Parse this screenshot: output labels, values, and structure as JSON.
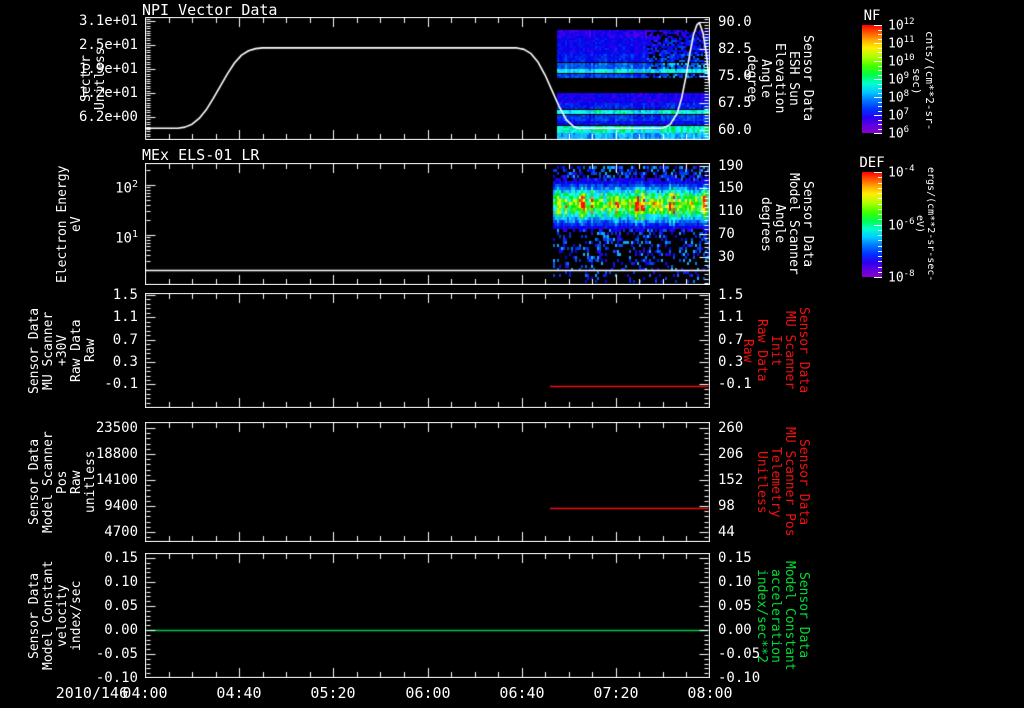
{
  "figure": {
    "background": "#000000",
    "axis_color": "#ffffff",
    "x_axis": {
      "date_label": "2010/146",
      "tick_labels": [
        "04:00",
        "04:40",
        "05:20",
        "06:00",
        "06:40",
        "07:20",
        "08:00"
      ],
      "minor_ticks_per_major": 4
    },
    "panels": [
      {
        "title": "NPI Vector Data",
        "left_label_lines": [
          "Sector",
          "Unitless"
        ],
        "left_tick_labels": [
          "3.1e+01",
          "2.5e+01",
          "1.9e+01",
          "1.2e+01",
          "6.2e+00"
        ],
        "right_tick_labels": [
          "90.0",
          "82.5",
          "75.0",
          "67.5",
          "60.0"
        ],
        "right_label_lines": [
          "Sensor Data",
          "ESH Sun Elevation",
          "Angle",
          "degree"
        ],
        "right_label_color": "#ffffff",
        "colorbar": {
          "title": "NF",
          "unit": "cnts/(cm**2-sr-sec)",
          "tick_mantissa": "10",
          "tick_exponents": [
            "12",
            "11",
            "10",
            "9",
            "8",
            "7",
            "6"
          ]
        }
      },
      {
        "title": "MEx ELS-01 LR",
        "left_label_lines": [
          "Electron Energy",
          "eV"
        ],
        "left_tick_labels_exp": [
          {
            "m": "10",
            "e": "2"
          },
          {
            "m": "10",
            "e": "1"
          }
        ],
        "right_tick_labels": [
          "190",
          "150",
          "110",
          "70",
          "30"
        ],
        "right_label_lines": [
          "Sensor Data",
          "Model Scanner",
          "Angle",
          "degrees"
        ],
        "right_label_color": "#ffffff",
        "colorbar": {
          "title": "DEF",
          "unit": "ergs/(cm**2-sr-sec-eV)",
          "tick_mantissa": "10",
          "tick_exponents": [
            "-4",
            "-6",
            "-8"
          ]
        }
      },
      {
        "left_label_lines": [
          "Sensor Data",
          "MU Scanner +30V",
          "Raw Data",
          "Raw"
        ],
        "left_tick_labels": [
          "1.5",
          "1.1",
          "0.7",
          "0.3",
          "-0.1"
        ],
        "right_tick_labels": [
          "1.5",
          "1.1",
          "0.7",
          "0.3",
          "-0.1"
        ],
        "right_label_lines": [
          "Sensor Data",
          "MU Scanner Init",
          "Raw Data",
          "Raw"
        ],
        "right_label_color": "#f01010"
      },
      {
        "left_label_lines": [
          "Sensor Data",
          "Model Scanner Pos",
          "Raw",
          "unitless"
        ],
        "left_tick_labels": [
          "23500",
          "18800",
          "14100",
          "9400",
          "4700"
        ],
        "right_tick_labels": [
          "260",
          "206",
          "152",
          "98",
          "44"
        ],
        "right_label_lines": [
          "Sensor Data",
          "MU Scanner Pos",
          "Telemetry",
          "Unitless"
        ],
        "right_label_color": "#f01010"
      },
      {
        "left_label_lines": [
          "Sensor Data",
          "Model Constant",
          "velocity",
          "index/sec"
        ],
        "left_tick_labels": [
          "0.15",
          "0.10",
          "0.05",
          "0.00",
          "-0.05",
          "-0.10"
        ],
        "right_tick_labels": [
          "0.15",
          "0.10",
          "0.05",
          "0.00",
          "-0.05",
          "-0.10"
        ],
        "right_label_lines": [
          "Sensor Data",
          "Model Constant",
          "acceleration",
          "index/sec**2"
        ],
        "right_label_color": "#00dd33"
      }
    ]
  },
  "chart_data": [
    {
      "type": "line",
      "panel": 1,
      "title": "NPI Vector Data",
      "x_axis": {
        "start": "2010/146 04:00",
        "end": "2010/146 08:00",
        "unit": "minutes after 04:00"
      },
      "left_axis": {
        "label": "Sector Unitless",
        "ticks": [
          31,
          25,
          19,
          12,
          6.2
        ]
      },
      "right_axis": {
        "label": "Sensor Data ESH Sun Elevation Angle degree",
        "ticks": [
          90.0,
          82.5,
          75.0,
          67.5,
          60.0
        ],
        "range": [
          60,
          90
        ]
      },
      "series": [
        {
          "name": "ESH Sun Elevation Angle",
          "axis": "right",
          "color": "#ffffff",
          "points_min_deg": [
            [
              0,
              60.5
            ],
            [
              14,
              60.5
            ],
            [
              17,
              60.8
            ],
            [
              20,
              61.6
            ],
            [
              23,
              63.2
            ],
            [
              26,
              65.6
            ],
            [
              29,
              68.8
            ],
            [
              32,
              72.2
            ],
            [
              35,
              75.6
            ],
            [
              38,
              78.6
            ],
            [
              41,
              80.8
            ],
            [
              44,
              82.0
            ],
            [
              47,
              82.6
            ],
            [
              50,
              82.8
            ],
            [
              158,
              82.8
            ],
            [
              161,
              82.4
            ],
            [
              164,
              81.2
            ],
            [
              167,
              78.8
            ],
            [
              170,
              75.2
            ],
            [
              173,
              70.8
            ],
            [
              176,
              66.4
            ],
            [
              179,
              62.8
            ],
            [
              182,
              61.0
            ],
            [
              184,
              60.5
            ],
            [
              220,
              60.5
            ],
            [
              223,
              61.5
            ],
            [
              226,
              64.5
            ],
            [
              228,
              69.0
            ],
            [
              230,
              75.5
            ],
            [
              231.5,
              81.5
            ],
            [
              233,
              86.5
            ],
            [
              234.5,
              89.3
            ],
            [
              235.5,
              89.8
            ],
            [
              237,
              87.0
            ],
            [
              238.5,
              81.0
            ],
            [
              239.5,
              74.5
            ],
            [
              240,
              71.0
            ]
          ]
        }
      ],
      "spectrogram": {
        "name": "NPI counts NF",
        "unit": "cnts/(cm**2-sr-sec)",
        "color_scale_range": [
          "1e6",
          "1e12"
        ],
        "starts_at_min": 172,
        "ends_at_min": 240,
        "bands": [
          {
            "y_frac_top": 0.105,
            "y_frac_bottom": 0.49,
            "description": "dark blue/purple rows, bright cyan stripe near band bottom, black dropouts and purple blobs on right third"
          },
          {
            "y_frac_top": 0.62,
            "y_frac_bottom": 1.0,
            "description": "blue/purple rows with two bright cyan stripes and light-blue bottom row"
          }
        ]
      }
    },
    {
      "type": "spectrogram",
      "panel": 2,
      "title": "MEx ELS-01 LR",
      "y_axis": {
        "label": "Electron Energy eV",
        "scale": "log",
        "ticks": [
          100,
          10
        ]
      },
      "right_axis": {
        "label": "Sensor Data Model Scanner Angle degrees",
        "ticks": [
          190,
          150,
          110,
          70,
          30
        ]
      },
      "color_scale": {
        "name": "DEF",
        "unit": "ergs/(cm**2-sr-sec-eV)",
        "range": [
          "1e-8",
          "1e-4"
        ]
      },
      "starts_at_min": 172,
      "ends_at_min": 240,
      "peak_band": {
        "energy_eV": [
          20,
          80
        ],
        "description": "bright green band with yellow/orange hotspots; blue speckle noise above and below"
      },
      "white_line": {
        "value_eV": 2.0,
        "start_min": 0,
        "end_min": 240,
        "color": "#ffffff"
      }
    },
    {
      "type": "line",
      "panel": 3,
      "y_ticks": [
        1.5,
        1.1,
        0.7,
        0.3,
        -0.1
      ],
      "series": [
        {
          "name": "MU Scanner Init Raw Data Raw",
          "color": "#f01010",
          "value": -0.15,
          "start_min": 172,
          "end_min": 240
        }
      ]
    },
    {
      "type": "line",
      "panel": 4,
      "left_ticks": [
        23500,
        18800,
        14100,
        9400,
        4700
      ],
      "right_ticks": [
        260,
        206,
        152,
        98,
        44
      ],
      "series": [
        {
          "name": "MU Scanner Pos Telemetry",
          "color": "#f01010",
          "value": 9000,
          "start_min": 172,
          "end_min": 240
        }
      ]
    },
    {
      "type": "line",
      "panel": 5,
      "y_ticks": [
        0.15,
        0.1,
        0.05,
        0.0,
        -0.05,
        -0.1
      ],
      "series": [
        {
          "name": "Model Constant velocity",
          "color": "#00cc44",
          "value": 0.0,
          "start_min": 0,
          "end_min": 240
        }
      ]
    }
  ]
}
